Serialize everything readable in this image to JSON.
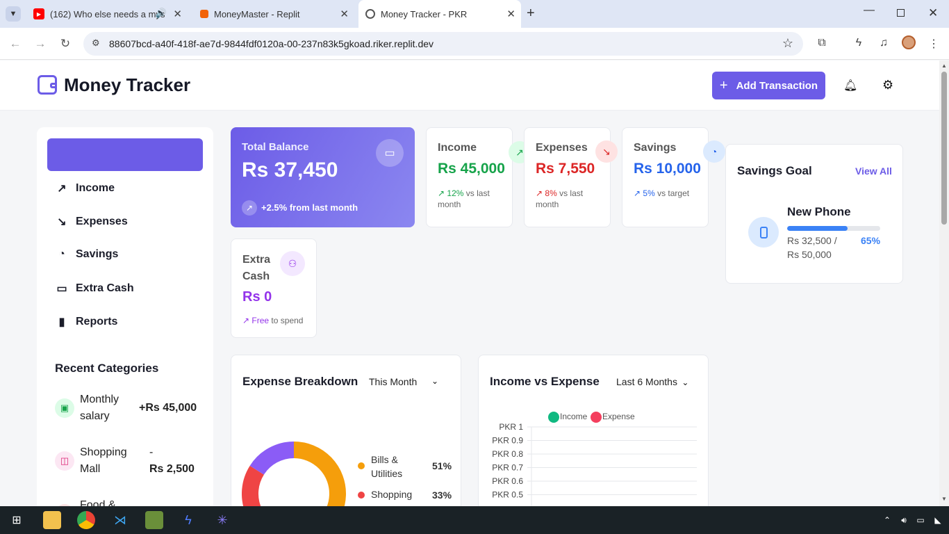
{
  "browser": {
    "tabs": [
      {
        "label": "(162) Who else needs a mys",
        "favicon": "youtube-icon",
        "color": "#ff0000"
      },
      {
        "label": "MoneyMaster - Replit",
        "favicon": "replit-icon",
        "color": "#f26207"
      },
      {
        "label": "Money Tracker - PKR",
        "favicon": "globe-icon",
        "color": "#555555"
      }
    ],
    "url": "88607bcd-a40f-418f-ae7d-9844fdf0120a-00-237n83k5gkoad.riker.replit.dev"
  },
  "header": {
    "title": "Money Tracker",
    "add_button": "Add Transaction",
    "accent": "#6c5ce7"
  },
  "sidebar": {
    "items": [
      {
        "label": "Income",
        "icon": "trending-up-icon"
      },
      {
        "label": "Expenses",
        "icon": "trending-down-icon"
      },
      {
        "label": "Savings",
        "icon": "piggy-bank-icon"
      },
      {
        "label": "Extra Cash",
        "icon": "wallet-icon"
      },
      {
        "label": "Reports",
        "icon": "bar-chart-icon"
      }
    ],
    "recent_title": "Recent Categories",
    "recent": [
      {
        "name": "Monthly salary",
        "amount": "+Rs 45,000",
        "icon": "briefcase-icon"
      },
      {
        "name": "Shopping Mall",
        "amount_sign": "-",
        "amount": "Rs 2,500",
        "icon": "shopping-bag-icon"
      },
      {
        "name": "Food &",
        "amount": "",
        "icon": "food-icon"
      }
    ]
  },
  "balance": {
    "title": "Total Balance",
    "value": "Rs 37,450",
    "change": "+2.5% from last month"
  },
  "stats": [
    {
      "title": "Income",
      "value": "Rs 45,000",
      "change": "12%",
      "suffix": "vs last month",
      "color": "#16a34a"
    },
    {
      "title": "Expenses",
      "value": "Rs 7,550",
      "change": "8%",
      "suffix": "vs last month",
      "color": "#dc2626"
    },
    {
      "title": "Savings",
      "value": "Rs 10,000",
      "change": "5%",
      "suffix": "vs target",
      "color": "#2563eb"
    }
  ],
  "extra": {
    "title": "Extra Cash",
    "value": "Rs 0",
    "change": "Free",
    "suffix": "to spend"
  },
  "goal": {
    "title": "Savings Goal",
    "link": "View All",
    "name": "New Phone",
    "progress_label": "Rs 32,500 / Rs 50,000",
    "percent_label": "65%",
    "progress": 0.65
  },
  "breakdown": {
    "title": "Expense Breakdown",
    "period": "This Month",
    "legend": [
      {
        "label": "Bills & Utilities",
        "pct": "51%",
        "color": "#f59e0b"
      },
      {
        "label": "Shopping",
        "pct": "33%",
        "color": "#ef4444"
      }
    ]
  },
  "chart_data": {
    "type": "line",
    "title": "Income vs Expense",
    "period": "Last 6 Months",
    "series": [
      {
        "name": "Income",
        "color": "#10b981",
        "values": []
      },
      {
        "name": "Expense",
        "color": "#f43f5e",
        "values": []
      }
    ],
    "yticks": [
      "PKR 1",
      "PKR 0.9",
      "PKR 0.8",
      "PKR 0.7",
      "PKR 0.6",
      "PKR 0.5"
    ],
    "ylim": [
      0,
      1
    ],
    "legend": "top-center",
    "grid": true
  }
}
